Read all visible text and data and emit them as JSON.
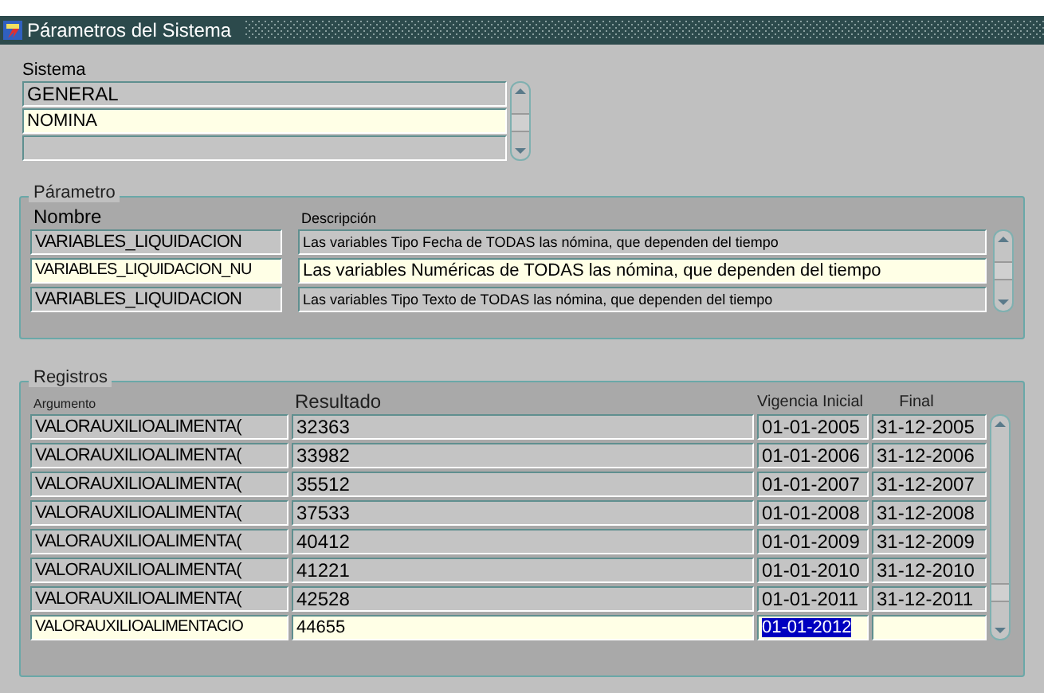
{
  "window": {
    "title": "Párametros del Sistema"
  },
  "sistema": {
    "label": "Sistema",
    "rows": [
      {
        "value": "GENERAL",
        "selected": false
      },
      {
        "value": "NOMINA",
        "selected": true
      },
      {
        "value": "",
        "selected": false
      }
    ]
  },
  "parametro": {
    "title": "Párametro",
    "columns": [
      "Nombre",
      "Descripción"
    ],
    "rows": [
      {
        "nombre": "VARIABLES_LIQUIDACION",
        "descripcion": "Las variables Tipo Fecha de TODAS las nómina, que dependen del tiempo",
        "selected": false
      },
      {
        "nombre": "VARIABLES_LIQUIDACION_NU",
        "descripcion": "Las variables Numéricas de TODAS las nómina, que dependen del tiempo",
        "selected": true
      },
      {
        "nombre": "VARIABLES_LIQUIDACION",
        "descripcion": "Las variables Tipo Texto de TODAS las nómina, que dependen del tiempo",
        "selected": false
      }
    ]
  },
  "registros": {
    "title": "Registros",
    "columns": [
      "Argumento",
      "Resultado",
      "Vigencia Inicial",
      "Final"
    ],
    "rows": [
      {
        "argumento": "VALORAUXILIOALIMENTA(",
        "resultado": "32363",
        "inicial": "01-01-2005",
        "final": "31-12-2005",
        "selected": false,
        "text_highlighted": false
      },
      {
        "argumento": "VALORAUXILIOALIMENTA(",
        "resultado": "33982",
        "inicial": "01-01-2006",
        "final": "31-12-2006",
        "selected": false,
        "text_highlighted": false
      },
      {
        "argumento": "VALORAUXILIOALIMENTA(",
        "resultado": "35512",
        "inicial": "01-01-2007",
        "final": "31-12-2007",
        "selected": false,
        "text_highlighted": false
      },
      {
        "argumento": "VALORAUXILIOALIMENTA(",
        "resultado": "37533",
        "inicial": "01-01-2008",
        "final": "31-12-2008",
        "selected": false,
        "text_highlighted": false
      },
      {
        "argumento": "VALORAUXILIOALIMENTA(",
        "resultado": "40412",
        "inicial": "01-01-2009",
        "final": "31-12-2009",
        "selected": false,
        "text_highlighted": false
      },
      {
        "argumento": "VALORAUXILIOALIMENTA(",
        "resultado": "41221",
        "inicial": "01-01-2010",
        "final": "31-12-2010",
        "selected": false,
        "text_highlighted": false
      },
      {
        "argumento": "VALORAUXILIOALIMENTA(",
        "resultado": "42528",
        "inicial": "01-01-2011",
        "final": "31-12-2011",
        "selected": false,
        "text_highlighted": false
      },
      {
        "argumento": "VALORAUXILIOALIMENTACIO",
        "resultado": "44655",
        "inicial": "01-01-2012",
        "final": "",
        "selected": true,
        "text_highlighted": true
      }
    ]
  }
}
